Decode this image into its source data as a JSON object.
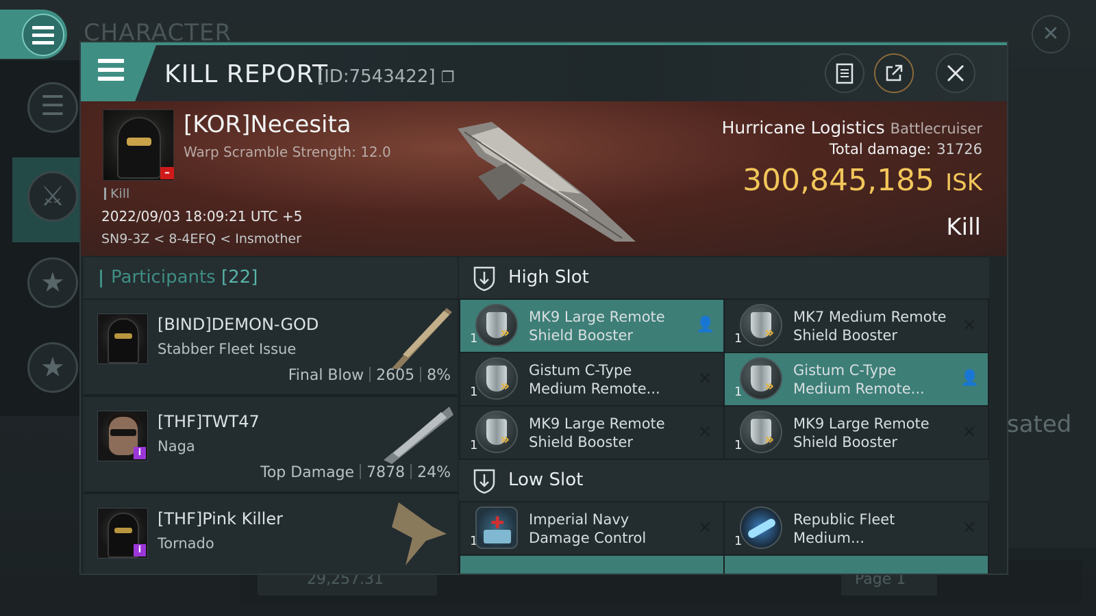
{
  "background": {
    "window_title": "CHARACTER",
    "side_text": "sated",
    "bottom_isk": "29,257.31",
    "page_label": "Page 1"
  },
  "header": {
    "title": "KILL REPORT",
    "id_text": "[ID:7543422]"
  },
  "victim": {
    "name": "[KOR]Necesita",
    "scramble": "Warp Scramble Strength: 12.0",
    "tag": "Kill",
    "datetime": "2022/09/03 18:09:21 UTC +5",
    "location": "SN9-3Z < 8-4EFQ < Insmother"
  },
  "ship": {
    "name": "Hurricane Logistics",
    "class": "Battlecruiser",
    "total_damage_label": "Total damage:",
    "total_damage": "31726",
    "isk_value": "300,845,185",
    "isk_unit": "ISK",
    "result": "Kill"
  },
  "participants": {
    "label": "Participants",
    "count": "[22]",
    "rows": [
      {
        "name": "[BIND]DEMON-GOD",
        "ship": "Stabber Fleet Issue",
        "role": "Final Blow",
        "damage": "2605",
        "percent": "8%"
      },
      {
        "name": "[THF]TWT47",
        "ship": "Naga",
        "role": "Top Damage",
        "damage": "7878",
        "percent": "24%"
      },
      {
        "name": "[THF]Pink Killer",
        "ship": "Tornado"
      }
    ]
  },
  "high_slot": {
    "label": "High Slot",
    "modules": [
      {
        "qty": "1",
        "name": "MK9 Large Remote Shield Booster"
      },
      {
        "qty": "1",
        "name": "MK7 Medium Remote Shield Booster"
      },
      {
        "qty": "1",
        "name": "Gistum C-Type Medium Remote..."
      },
      {
        "qty": "1",
        "name": "Gistum C-Type Medium Remote..."
      },
      {
        "qty": "1",
        "name": "MK9 Large Remote Shield Booster"
      },
      {
        "qty": "1",
        "name": "MK9 Large Remote Shield Booster"
      }
    ]
  },
  "low_slot": {
    "label": "Low Slot",
    "modules": [
      {
        "qty": "1",
        "name": "Imperial Navy Damage Control"
      },
      {
        "qty": "1",
        "name": "Republic Fleet Medium..."
      }
    ]
  },
  "colors": {
    "accent": "#3f8e84",
    "isk": "#f2c65a",
    "dropped": "#3d7e77",
    "info_badge": "#9b36d9",
    "victim_badge": "#d01a1a"
  }
}
